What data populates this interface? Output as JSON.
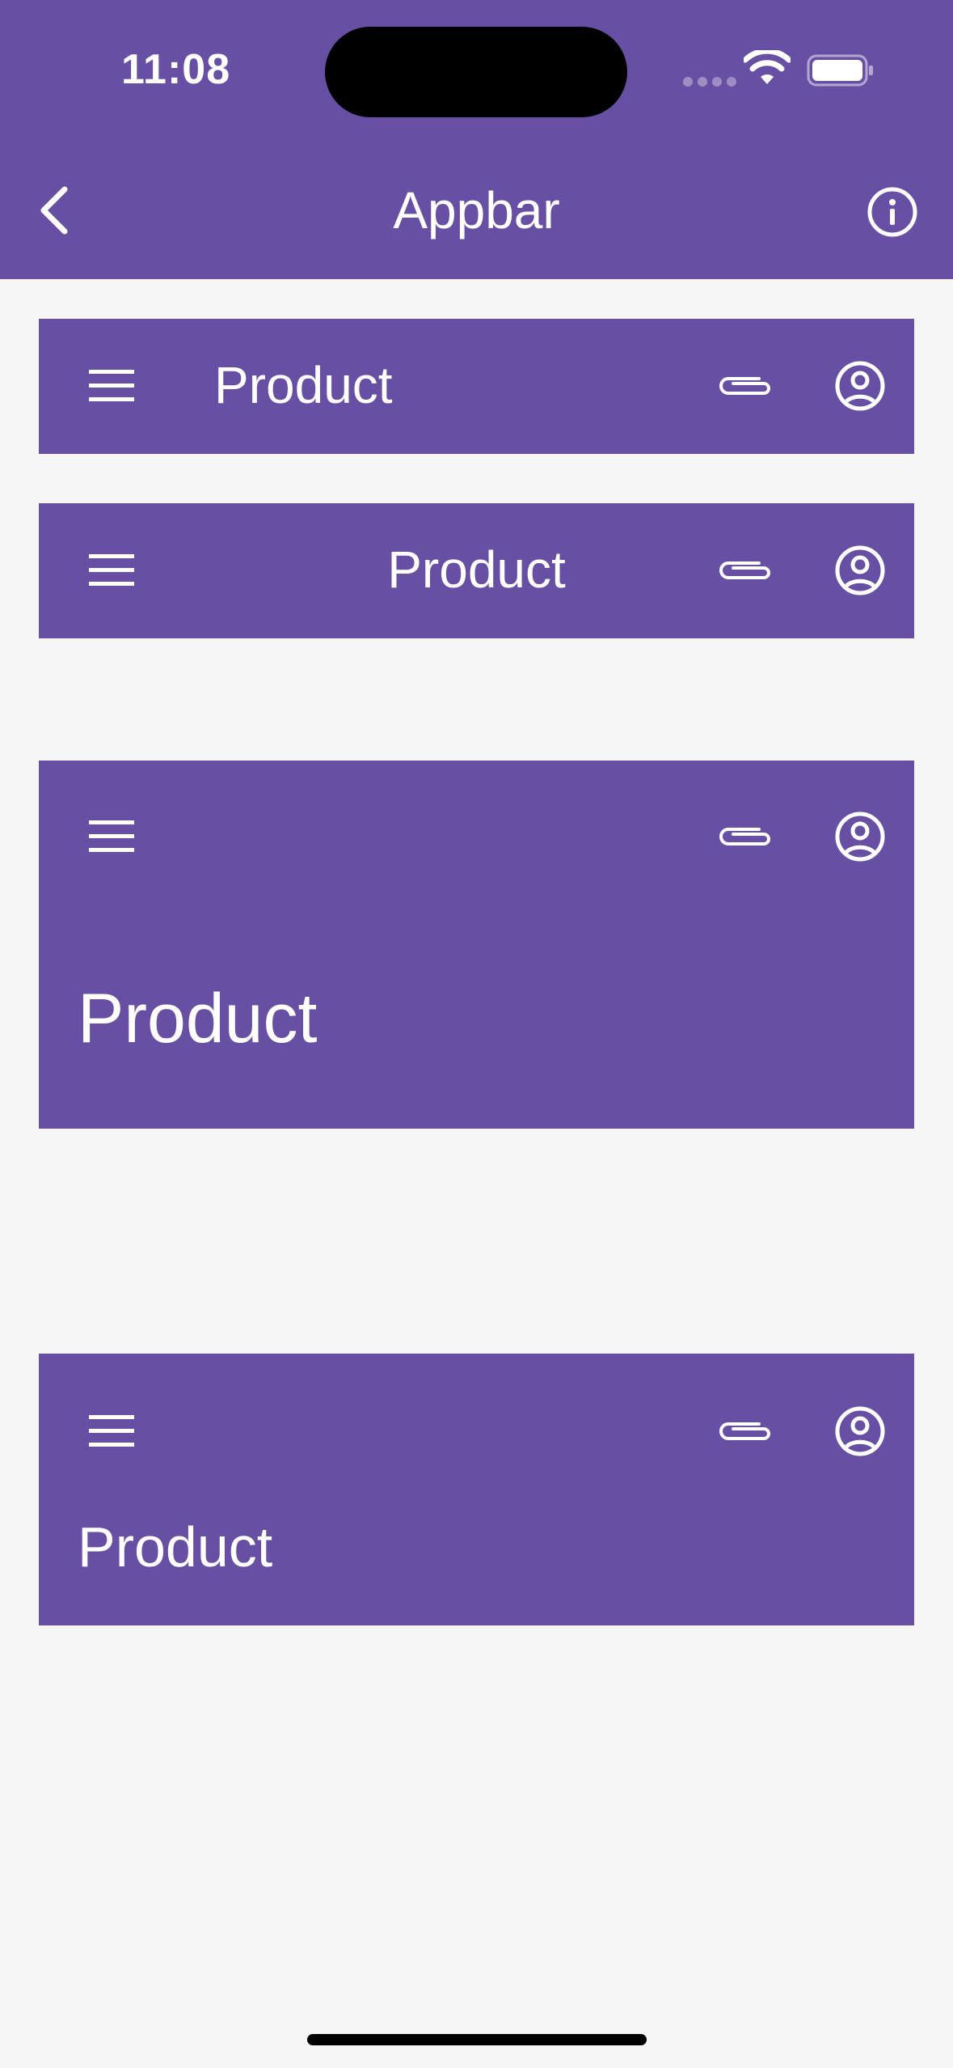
{
  "status_bar": {
    "time": "11:08",
    "icons": [
      "cellular-signal-icon",
      "wifi-icon",
      "battery-icon"
    ]
  },
  "nav": {
    "title": "Appbar",
    "back_icon": "chevron-left-icon",
    "info_icon": "info-icon"
  },
  "colors": {
    "primary": "#6750a4",
    "on_primary": "#ffffff",
    "background": "#f6f6f6"
  },
  "appbars": [
    {
      "variant": "small",
      "title": "Product",
      "icons": [
        "menu-icon",
        "paperclip-icon",
        "account-circle-icon"
      ]
    },
    {
      "variant": "center-aligned",
      "title": "Product",
      "icons": [
        "menu-icon",
        "paperclip-icon",
        "account-circle-icon"
      ]
    },
    {
      "variant": "large",
      "title": "Product",
      "icons": [
        "menu-icon",
        "paperclip-icon",
        "account-circle-icon"
      ]
    },
    {
      "variant": "medium",
      "title": "Product",
      "icons": [
        "menu-icon",
        "paperclip-icon",
        "account-circle-icon"
      ]
    }
  ]
}
